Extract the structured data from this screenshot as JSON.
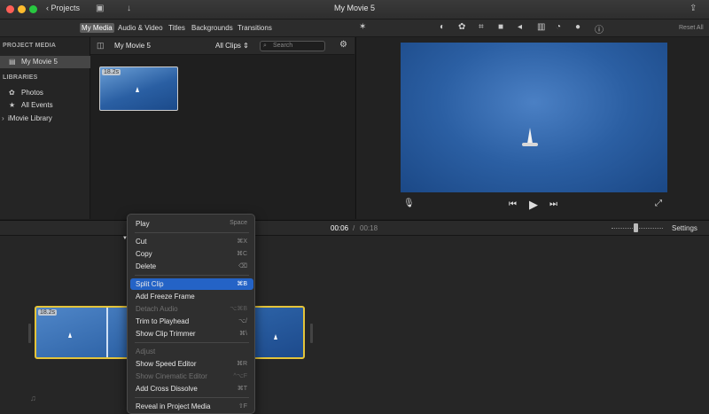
{
  "window": {
    "title": "My Movie 5",
    "projects_label": "Projects",
    "traffic_lights": {
      "close": "#ff5f57",
      "minimize": "#febc2e",
      "zoom": "#28c840"
    }
  },
  "tabs": [
    {
      "label": "My Media",
      "active": true
    },
    {
      "label": "Audio & Video",
      "active": false
    },
    {
      "label": "Titles",
      "active": false
    },
    {
      "label": "Backgrounds",
      "active": false
    },
    {
      "label": "Transitions",
      "active": false
    }
  ],
  "viewer_toolbar": {
    "reset_all": "Reset All",
    "icons": [
      "color-balance-icon",
      "color-correction-icon",
      "crop-icon",
      "stabilization-icon",
      "volume-icon",
      "noise-reduction-icon",
      "speed-icon",
      "clip-filter-icon",
      "info-icon"
    ]
  },
  "sidebar": {
    "project_media_header": "PROJECT MEDIA",
    "project_item": "My Movie 5",
    "libraries_header": "LIBRARIES",
    "library_items": [
      "Photos",
      "All Events",
      "iMovie Library"
    ]
  },
  "browser": {
    "title": "My Movie 5",
    "filter": "All Clips",
    "search_placeholder": "Search",
    "clip_duration": "18.2s"
  },
  "timeline": {
    "current_time": "00:06",
    "separator": "/",
    "total_time": "00:18",
    "settings_label": "Settings",
    "clip_duration": "18.2s"
  },
  "context_menu": {
    "groups": [
      [
        {
          "label": "Play",
          "shortcut": "Space",
          "enabled": true
        }
      ],
      [
        {
          "label": "Cut",
          "shortcut": "⌘X",
          "enabled": true
        },
        {
          "label": "Copy",
          "shortcut": "⌘C",
          "enabled": true
        },
        {
          "label": "Delete",
          "shortcut": "⌫",
          "enabled": true
        }
      ],
      [
        {
          "label": "Split Clip",
          "shortcut": "⌘B",
          "enabled": true,
          "highlighted": true
        },
        {
          "label": "Add Freeze Frame",
          "shortcut": "",
          "enabled": true
        },
        {
          "label": "Detach Audio",
          "shortcut": "⌥⌘B",
          "enabled": false
        },
        {
          "label": "Trim to Playhead",
          "shortcut": "⌥/",
          "enabled": true
        },
        {
          "label": "Show Clip Trimmer",
          "shortcut": "⌘\\",
          "enabled": true
        }
      ],
      [
        {
          "label": "Adjust",
          "shortcut": "",
          "enabled": false
        },
        {
          "label": "Show Speed Editor",
          "shortcut": "⌘R",
          "enabled": true
        },
        {
          "label": "Show Cinematic Editor",
          "shortcut": "^⌥F",
          "enabled": false
        },
        {
          "label": "Add Cross Dissolve",
          "shortcut": "⌘T",
          "enabled": true
        }
      ],
      [
        {
          "label": "Reveal in Project Media",
          "shortcut": "⇧F",
          "enabled": true
        }
      ]
    ]
  },
  "colors": {
    "accent_highlight": "#2463c6",
    "clip_border": "#e4c43a"
  }
}
